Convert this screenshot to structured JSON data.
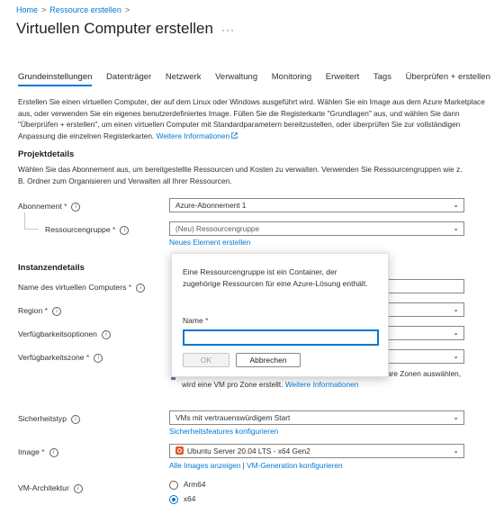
{
  "breadcrumb": {
    "home": "Home",
    "create": "Ressource erstellen",
    "sep": ">"
  },
  "page": {
    "title": "Virtuellen Computer erstellen",
    "more": "···"
  },
  "tabs": [
    {
      "label": "Grundeinstellungen",
      "active": true
    },
    {
      "label": "Datenträger"
    },
    {
      "label": "Netzwerk"
    },
    {
      "label": "Verwaltung"
    },
    {
      "label": "Monitoring"
    },
    {
      "label": "Erweitert"
    },
    {
      "label": "Tags"
    },
    {
      "label": "Überprüfen + erstellen"
    }
  ],
  "intro": {
    "text": "Erstellen Sie einen virtuellen Computer, der auf dem Linux oder Windows ausgeführt wird. Wählen Sie ein Image aus dem Azure Marketplace aus, oder verwenden Sie ein eigenes benutzerdefiniertes Image. Füllen Sie die Registerkarte \"Grundlagen\" aus, und wählen Sie dann \"Überprüfen + erstellen\", um einen virtuellen Computer mit Standardparametern bereitzustellen, oder überprüfen Sie zur vollständigen Anpassung die einzelnen Registerkarten.",
    "link": "Weitere Informationen",
    "link_icon": "external-link-icon"
  },
  "project": {
    "heading": "Projektdetails",
    "desc": "Wählen Sie das Abonnement aus, um bereitgestellte Ressourcen und Kosten zu verwalten. Verwenden Sie Ressourcengruppen wie z. B. Ordner zum Organisieren und Verwalten all Ihrer Ressourcen.",
    "subscription_label": "Abonnement",
    "subscription_value": "Azure-Abonnement 1",
    "rg_label": "Ressourcengruppe",
    "rg_placeholder": "(Neu) Ressourcengruppe",
    "rg_new_link": "Neues Element erstellen"
  },
  "instance": {
    "heading": "Instanzendetails",
    "vmname_label": "Name des virtuellen Computers",
    "region_label": "Region",
    "availability_label": "Verfügbarkeitsoptionen",
    "zone_label": "Verfügbarkeitszone",
    "zone_note_tail": "are Zonen auswählen,",
    "zone_note_2": "wird eine VM pro Zone erstellt.",
    "zone_link": "Weitere Informationen",
    "security_label": "Sicherheitstyp",
    "security_value": "VMs mit vertrauenswürdigem Start",
    "security_link": "Sicherheitsfeatures konfigurieren",
    "image_label": "Image",
    "image_value": "Ubuntu Server 20.04 LTS - x64 Gen2",
    "image_link_all": "Alle Images anzeigen",
    "image_link_sep": "|",
    "image_link_gen": "VM-Generation konfigurieren",
    "arch_label": "VM-Architektur",
    "arch_options": [
      "Arm64",
      "x64"
    ]
  },
  "popup": {
    "text": "Eine Ressourcengruppe ist ein Container, der zugehörige Ressourcen für eine Azure-Lösung enthält.",
    "name_label": "Name",
    "name_value": "",
    "ok": "OK",
    "cancel": "Abbrechen"
  },
  "required_mark": "*",
  "info_glyph": "i",
  "dropdown_glyph": "⌄",
  "colors": {
    "accent": "#0078d4",
    "required": "#a4262c",
    "ubuntu": "#e95420",
    "purple": "#8764b8"
  }
}
